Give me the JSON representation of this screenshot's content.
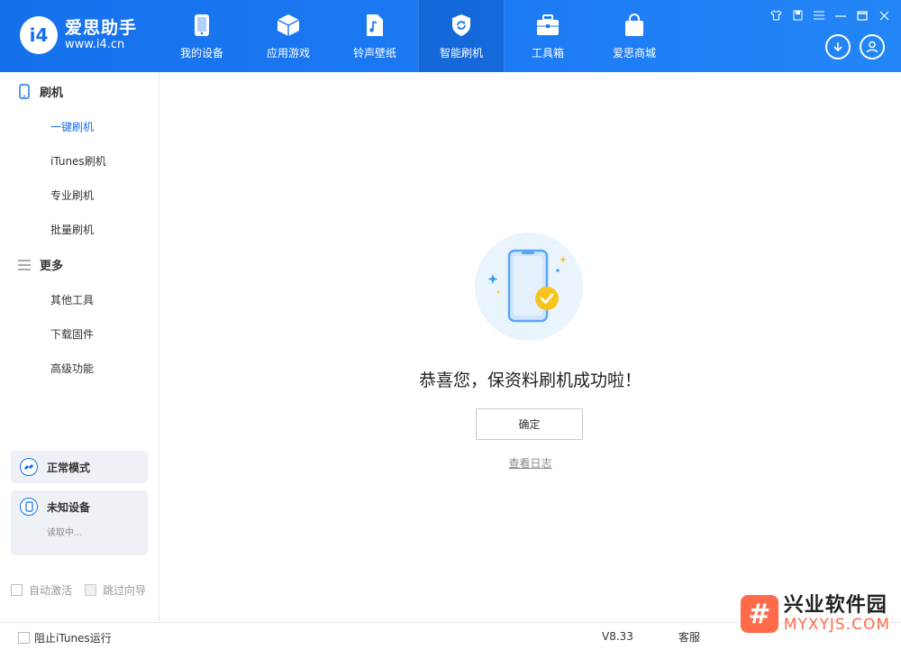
{
  "app": {
    "title": "爱思助手",
    "url": "www.i4.cn",
    "logo_mark": "i4",
    "accent_color": "#1570ec"
  },
  "nav": {
    "items": [
      {
        "label": "我的设备",
        "icon": "phone-icon"
      },
      {
        "label": "应用游戏",
        "icon": "cube-icon"
      },
      {
        "label": "铃声壁纸",
        "icon": "music-file-icon"
      },
      {
        "label": "智能刷机",
        "icon": "shield-refresh-icon",
        "active": true
      },
      {
        "label": "工具箱",
        "icon": "toolbox-icon"
      },
      {
        "label": "爱思商城",
        "icon": "shopping-bag-icon"
      }
    ]
  },
  "sidebar": {
    "sections": [
      {
        "title": "刷机",
        "icon": "phone-outline-icon",
        "items": [
          "一键刷机",
          "iTunes刷机",
          "专业刷机",
          "批量刷机"
        ],
        "active_index": 0
      },
      {
        "title": "更多",
        "icon": "menu-icon",
        "items": [
          "其他工具",
          "下载固件",
          "高级功能"
        ]
      }
    ],
    "mode_label": "正常模式",
    "device_label": "未知设备",
    "device_status": "读取中...",
    "options": [
      "自动激活",
      "跳过向导"
    ]
  },
  "main": {
    "success_message": "恭喜您，保资料刷机成功啦！",
    "confirm_label": "确定",
    "log_link": "查看日志"
  },
  "footer": {
    "block_itunes_label": "阻止iTunes运行",
    "version": "V8.33",
    "service": "客服"
  },
  "watermark": {
    "mark": "#",
    "name": "兴业软件园",
    "domain": "MYXYJS.COM"
  }
}
